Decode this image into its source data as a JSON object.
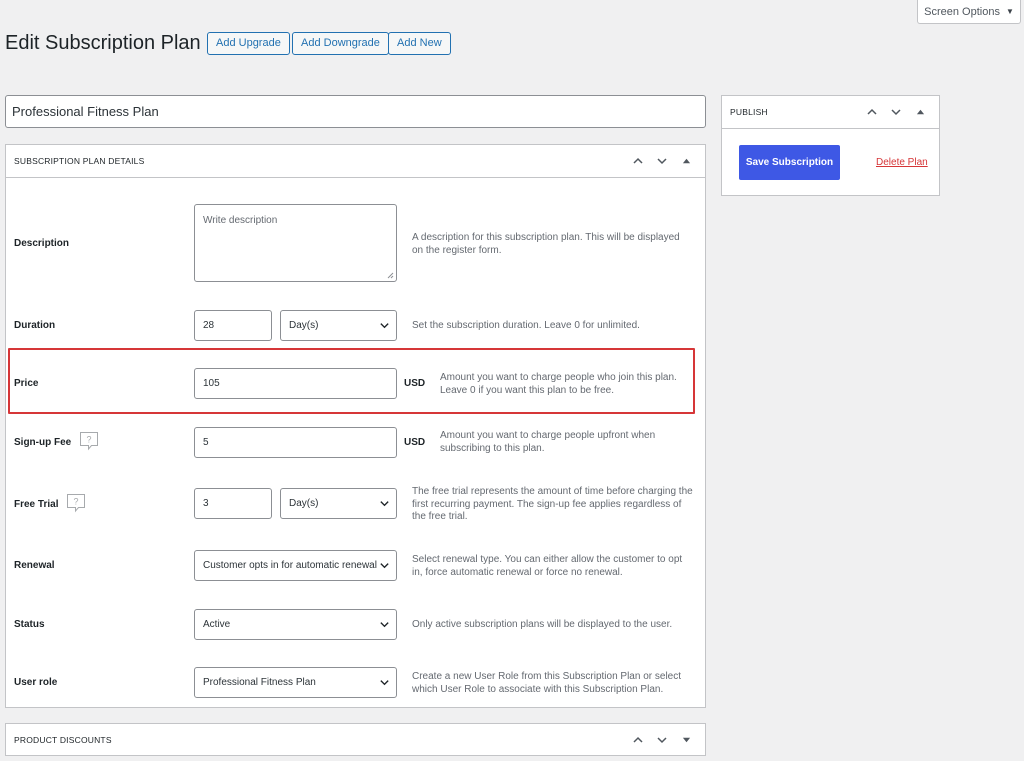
{
  "screen_options": {
    "label": "Screen Options",
    "arrow": "▼"
  },
  "header": {
    "title": "Edit Subscription Plan",
    "buttons": [
      "Add Upgrade",
      "Add Downgrade",
      "Add New"
    ]
  },
  "plan_title": "Professional Fitness Plan",
  "details": {
    "heading": "SUBSCRIPTION PLAN DETAILS",
    "description": {
      "label": "Description",
      "placeholder": "Write description",
      "help": "A description for this subscription plan. This will be displayed on the register form."
    },
    "duration": {
      "label": "Duration",
      "value": "28",
      "unit": "Day(s)",
      "help": "Set the subscription duration. Leave 0 for unlimited."
    },
    "price": {
      "label": "Price",
      "value": "105",
      "currency": "USD",
      "help": "Amount you want to charge people who join this plan. Leave 0 if you want this plan to be free."
    },
    "signup_fee": {
      "label": "Sign-up Fee",
      "value": "5",
      "currency": "USD",
      "help": "Amount you want to charge people upfront when subscribing to this plan."
    },
    "free_trial": {
      "label": "Free Trial",
      "value": "3",
      "unit": "Day(s)",
      "help": "The free trial represents the amount of time before charging the first recurring payment. The sign-up fee applies regardless of the free trial."
    },
    "renewal": {
      "label": "Renewal",
      "value": "Customer opts in for automatic renewal",
      "help": "Select renewal type. You can either allow the customer to opt in, force automatic renewal or force no renewal."
    },
    "status": {
      "label": "Status",
      "value": "Active",
      "help": "Only active subscription plans will be displayed to the user."
    },
    "user_role": {
      "label": "User role",
      "value": "Professional Fitness Plan",
      "help": "Create a new User Role from this Subscription Plan or select which User Role to associate with this Subscription Plan."
    }
  },
  "product_discounts": {
    "heading": "PRODUCT DISCOUNTS"
  },
  "publish": {
    "heading": "PUBLISH",
    "save_label": "Save Subscription",
    "delete_label": "Delete Plan"
  },
  "colors": {
    "primary": "#3e58e5",
    "link": "#2271b1",
    "danger": "#d63638",
    "background": "#f0f0f1"
  },
  "icons": [
    "chevron-up-icon",
    "chevron-down-icon",
    "triangle-up-icon",
    "triangle-down-icon",
    "help-bubble-icon"
  ]
}
